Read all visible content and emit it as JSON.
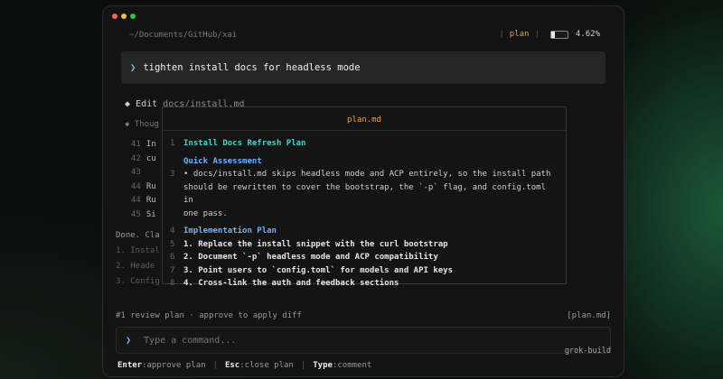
{
  "header": {
    "path": "~/Documents/GitHub/xai",
    "mode": "plan",
    "context_pct_label": "4.62%",
    "context_fraction": 0.0462
  },
  "prompt": {
    "text": "tighten install docs for headless mode"
  },
  "edit": {
    "verb": "Edit",
    "file": "docs/install.md"
  },
  "thought": "Thoug",
  "code_lines": [
    {
      "num": "41",
      "text": "In"
    },
    {
      "num": "42",
      "text": "cu"
    },
    {
      "num": "43",
      "text": ""
    },
    {
      "num": "44",
      "text": "Ru"
    },
    {
      "num": "44",
      "text": "Ru"
    },
    {
      "num": "45",
      "text": "Si"
    }
  ],
  "done_text": "Done. Cla",
  "bg_list": [
    "1. Instal",
    "2. Heade",
    "3. Config"
  ],
  "plan_popup": {
    "title": "plan.md",
    "lines": [
      {
        "num": "1",
        "text": "Install Docs Refresh Plan",
        "style": "head"
      },
      {
        "num": "",
        "text": "Quick Assessment",
        "style": "sub",
        "gap": true
      },
      {
        "num": "3",
        "text": "• docs/install.md skips headless mode and ACP entirely, so the install path",
        "style": ""
      },
      {
        "num": "",
        "text": "should be rewritten to cover the bootstrap, the `-p` flag, and config.toml in",
        "style": ""
      },
      {
        "num": "",
        "text": "one pass.",
        "style": ""
      },
      {
        "num": "4",
        "text": "Implementation Plan",
        "style": "sub",
        "gap": true
      },
      {
        "num": "5",
        "text": "1. Replace the install snippet with the curl bootstrap",
        "style": "bold"
      },
      {
        "num": "6",
        "text": "2. Document `-p` headless mode and ACP compatibility",
        "style": "bold"
      },
      {
        "num": "7",
        "text": "3. Point users to `config.toml` for models and API keys",
        "style": "bold"
      },
      {
        "num": "8",
        "text": "4. Cross-link the auth and feedback sections",
        "style": "bold"
      }
    ]
  },
  "review": {
    "text": "#1 review plan · approve to apply diff",
    "tag": "[plan.md]"
  },
  "command": {
    "placeholder": "Type a command...",
    "agent": "grok-build"
  },
  "hints": [
    {
      "key": "Enter",
      "desc": "approve plan"
    },
    {
      "key": "Esc",
      "desc": "close plan"
    },
    {
      "key": "Type",
      "desc": "comment"
    }
  ]
}
